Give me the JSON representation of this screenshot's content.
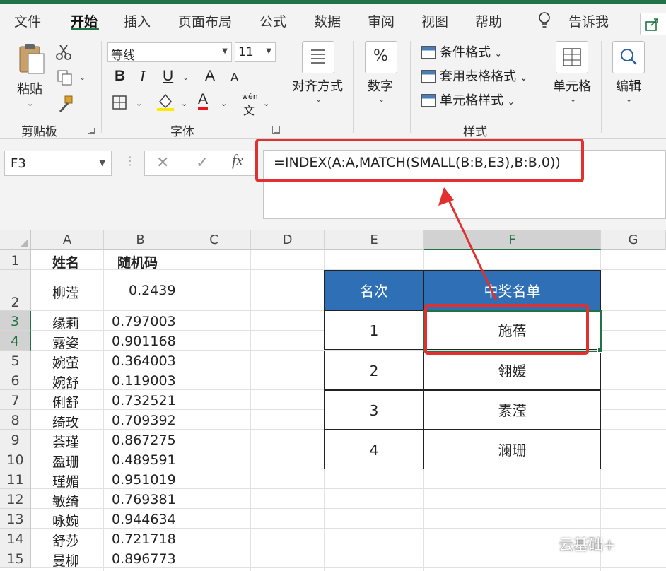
{
  "menu": {
    "tabs": [
      {
        "label": "文件"
      },
      {
        "label": "开始"
      },
      {
        "label": "插入"
      },
      {
        "label": "页面布局"
      },
      {
        "label": "公式"
      },
      {
        "label": "数据"
      },
      {
        "label": "审阅"
      },
      {
        "label": "视图"
      },
      {
        "label": "帮助"
      }
    ],
    "tell_me": "告诉我"
  },
  "ribbon": {
    "clipboard": {
      "paste": "粘贴",
      "group": "剪贴板"
    },
    "font": {
      "name": "等线",
      "size": "11",
      "group": "字体",
      "bold": "B",
      "italic": "I",
      "underline": "U",
      "grow": "A",
      "shrink": "A",
      "color": "A",
      "phonetic_top": "wén",
      "phonetic_bottom": "文"
    },
    "alignment": {
      "label": "对齐方式"
    },
    "number": {
      "label": "数字",
      "symbol": "%"
    },
    "styles": {
      "conditional": "条件格式",
      "table": "套用表格格式",
      "cell": "单元格样式",
      "group": "样式"
    },
    "cells": {
      "label": "单元格"
    },
    "editing": {
      "label": "编辑"
    }
  },
  "formula_bar": {
    "name_box": "F3",
    "cancel": "✕",
    "enter": "✓",
    "fx": "fx",
    "formula": "=INDEX(A:A,MATCH(SMALL(B:B,E3),B:B,0))"
  },
  "columns": [
    "A",
    "B",
    "C",
    "D",
    "E",
    "F",
    "G"
  ],
  "rows": [
    "1",
    "2",
    "3",
    "4",
    "5",
    "6",
    "7",
    "8",
    "9",
    "10",
    "11",
    "12",
    "13",
    "14",
    "15"
  ],
  "sheet": {
    "header_name": "姓名",
    "header_code": "随机码",
    "data": [
      {
        "name": "柳滢",
        "code": "0.2439"
      },
      {
        "name": "缘莉",
        "code": "0.797003"
      },
      {
        "name": "露姿",
        "code": "0.901168"
      },
      {
        "name": "婉萤",
        "code": "0.364003"
      },
      {
        "name": "婉舒",
        "code": "0.119003"
      },
      {
        "name": "俐舒",
        "code": "0.732521"
      },
      {
        "name": "绮玫",
        "code": "0.709392"
      },
      {
        "name": "荟瑾",
        "code": "0.867275"
      },
      {
        "name": "盈珊",
        "code": "0.489591"
      },
      {
        "name": "瑾媚",
        "code": "0.951019"
      },
      {
        "name": "敏绮",
        "code": "0.769381"
      },
      {
        "name": "咏婉",
        "code": "0.944634"
      },
      {
        "name": "舒莎",
        "code": "0.721718"
      },
      {
        "name": "曼柳",
        "code": "0.896773"
      }
    ]
  },
  "winners": {
    "rank_header": "名次",
    "list_header": "中奖名单",
    "rows": [
      {
        "rank": "1",
        "name": "施蓓"
      },
      {
        "rank": "2",
        "name": "翎媛"
      },
      {
        "rank": "3",
        "name": "素滢"
      },
      {
        "rank": "4",
        "name": "澜珊"
      }
    ]
  },
  "watermark": "云基础+",
  "colors": {
    "accent": "#217346",
    "table_header": "#2e6fb5",
    "highlight": "#e03030"
  }
}
